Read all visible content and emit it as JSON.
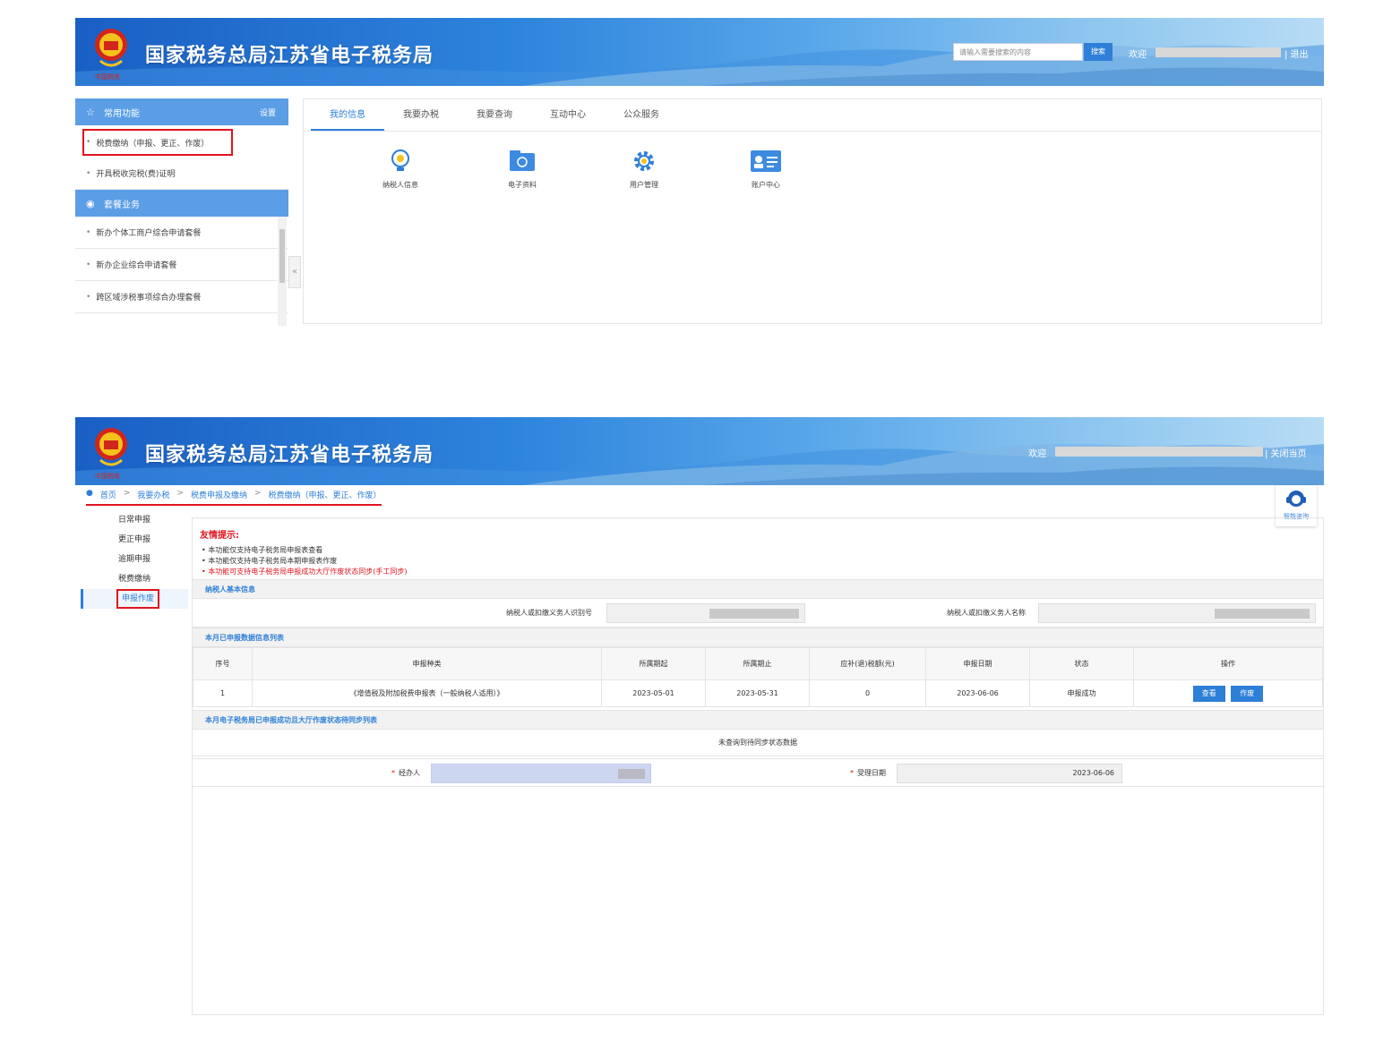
{
  "site_title": "国家税务总局江苏省电子税务局",
  "colors": {
    "primary": "#2d7fd8",
    "highlight_red": "#e0141e",
    "banner_dark": "#1a5fc4"
  },
  "screen1": {
    "header": {
      "search_placeholder": "请输入需要搜索的内容",
      "search_button": "搜索",
      "welcome": "欢迎",
      "logout": "| 退出"
    },
    "sidebar": {
      "common_title": "常用功能",
      "common_setting": "设置",
      "common_items": [
        "税费缴纳（申报、更正、作废）",
        "开具税收完税(费)证明"
      ],
      "package_title": "套餐业务",
      "package_items": [
        "新办个体工商户综合申请套餐",
        "新办企业综合申请套餐",
        "跨区域涉税事项综合办理套餐"
      ]
    },
    "tabs": [
      "我的信息",
      "我要办税",
      "我要查询",
      "互动中心",
      "公众服务"
    ],
    "tiles": [
      {
        "label": "纳税人信息",
        "icon": "info-bulb-icon"
      },
      {
        "label": "电子资料",
        "icon": "folder-icon"
      },
      {
        "label": "用户管理",
        "icon": "gear-icon"
      },
      {
        "label": "账户中心",
        "icon": "id-card-icon"
      }
    ]
  },
  "screen2": {
    "header": {
      "welcome": "欢迎",
      "close_page": "| 关闭当页"
    },
    "breadcrumb": [
      "首页",
      "我要办税",
      "税费申报及缴纳",
      "税费缴纳（申报、更正、作废）"
    ],
    "assistant": "智能咨询",
    "side_nav": [
      "日常申报",
      "更正申报",
      "逾期申报",
      "税费缴纳",
      "申报作废"
    ],
    "tips": {
      "title": "友情提示:",
      "items": [
        "本功能仅支持电子税务局申报表查看",
        "本功能仅支持电子税务局本期申报表作废",
        "本功能可支持电子税务局申报成功大厅作废状态同步(手工同步)"
      ]
    },
    "taxpayer_section": "纳税人基本信息",
    "taxpayer_id_label": "纳税人或扣缴义务人识别号",
    "taxpayer_name_label": "纳税人或扣缴义务人名称",
    "declared_section": "本月已申报数据信息列表",
    "table": {
      "headers": [
        "序号",
        "申报种类",
        "所属期起",
        "所属期止",
        "应补(退)税额(元)",
        "申报日期",
        "状态",
        "操作"
      ],
      "rows": [
        [
          "1",
          "《增值税及附加税费申报表（一般纳税人适用）》",
          "2023-05-01",
          "2023-05-31",
          "0",
          "2023-06-06",
          "申报成功"
        ]
      ],
      "view_button": "查看",
      "void_button": "作废"
    },
    "sync_section": "本月电子税务局已申报成功且大厅作废状态待同步列表",
    "no_data": "未查询到待同步状态数据",
    "handler_label": "经办人",
    "accept_date_label": "受理日期",
    "accept_date_value": "2023-06-06"
  }
}
